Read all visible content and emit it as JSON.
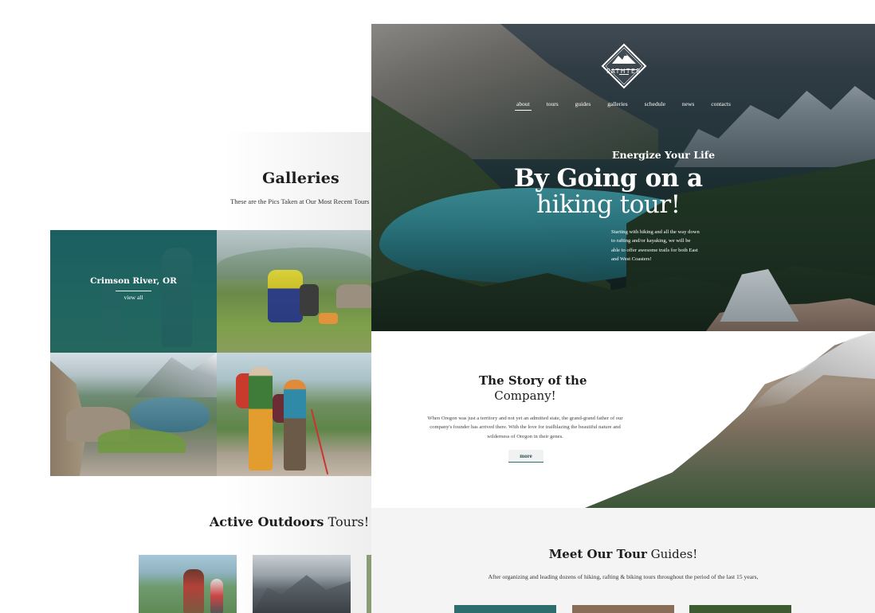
{
  "galleries": {
    "title": "Galleries",
    "subtitle": "These are the Pics Taken at Our Most Recent Tours",
    "featured": {
      "caption": "Crimson River, OR",
      "link_label": "view all"
    }
  },
  "active_tours": {
    "title_bold": "Active Outdoors",
    "title_rest": " Tours!"
  },
  "brand": {
    "name": "PATHTER",
    "icon": "mountain-logo-icon"
  },
  "nav": {
    "items": [
      {
        "label": "about",
        "active": true
      },
      {
        "label": "tours"
      },
      {
        "label": "guides"
      },
      {
        "label": "galleries"
      },
      {
        "label": "schedule"
      },
      {
        "label": "news"
      },
      {
        "label": "contacts"
      }
    ]
  },
  "hero": {
    "tagline": "Energize Your Life",
    "title_line1": "By Going on a",
    "title_line2": "hiking tour!",
    "description": "Starting with hiking and all the way down to rafting and/or kayaking, we will be able to offer awesome trails for both East and West Coasters!"
  },
  "story": {
    "title_line1": "The Story of the",
    "title_line2": "Company!",
    "body": "When Oregon was just a territory and not yet an admitted state, the grand-grand father of our company's founder has arrived there. With the love for trailblazing the beautiful nature and wilderness of Oregon in their genes.",
    "more_label": "more"
  },
  "guides": {
    "title_bold": "Meet Our Tour",
    "title_rest": " Guides!",
    "subtitle": "After organizing and leading dozens of hiking, rafting & biking tours throughout the period of the last 15 years,"
  },
  "colors": {
    "accent": "#2e6f74",
    "overlay_teal": "#145a5f",
    "text_dark": "#1d1d1d",
    "section_bg": "#f4f4f4"
  }
}
